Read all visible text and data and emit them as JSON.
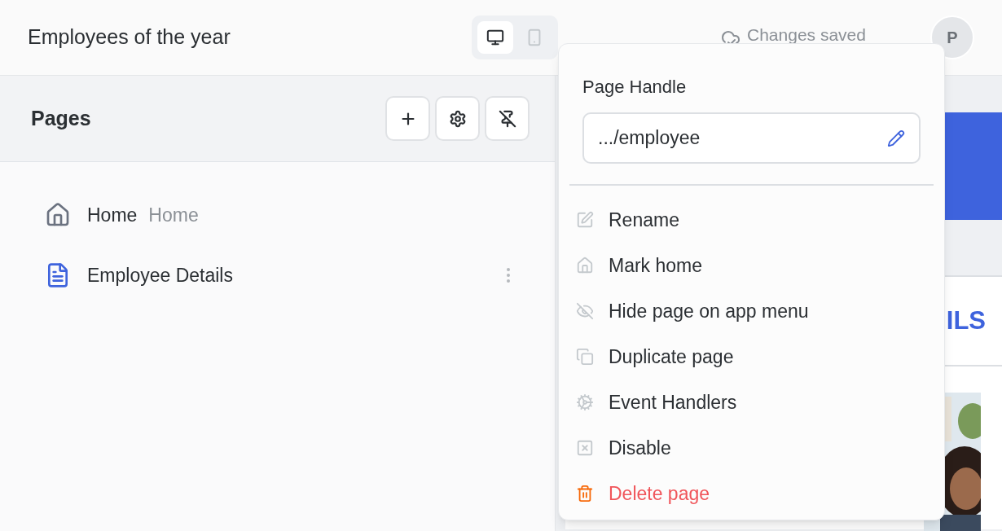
{
  "header": {
    "title": "Employees of the year",
    "devices": [
      {
        "kind": "desktop",
        "selected": true
      },
      {
        "kind": "mobile",
        "selected": false
      }
    ],
    "status": "Changes saved",
    "avatar": "P"
  },
  "sidebar": {
    "title": "Pages",
    "pages": [
      {
        "kind": "home",
        "name": "Home",
        "tag": "Home",
        "selected": false
      },
      {
        "kind": "page",
        "name": "Employee Details",
        "selected": true
      }
    ]
  },
  "canvas": {
    "heading": "ILS"
  },
  "menu": {
    "handle_label": "Page Handle",
    "handle_value": ".../employee",
    "items": [
      {
        "kind": "normal",
        "label": "Rename"
      },
      {
        "kind": "normal",
        "label": "Mark home"
      },
      {
        "kind": "normal",
        "label": "Hide page on app menu"
      },
      {
        "kind": "normal",
        "label": "Duplicate page"
      },
      {
        "kind": "normal",
        "label": "Event Handlers"
      },
      {
        "kind": "normal",
        "label": "Disable"
      },
      {
        "kind": "danger",
        "label": "Delete page"
      }
    ]
  }
}
